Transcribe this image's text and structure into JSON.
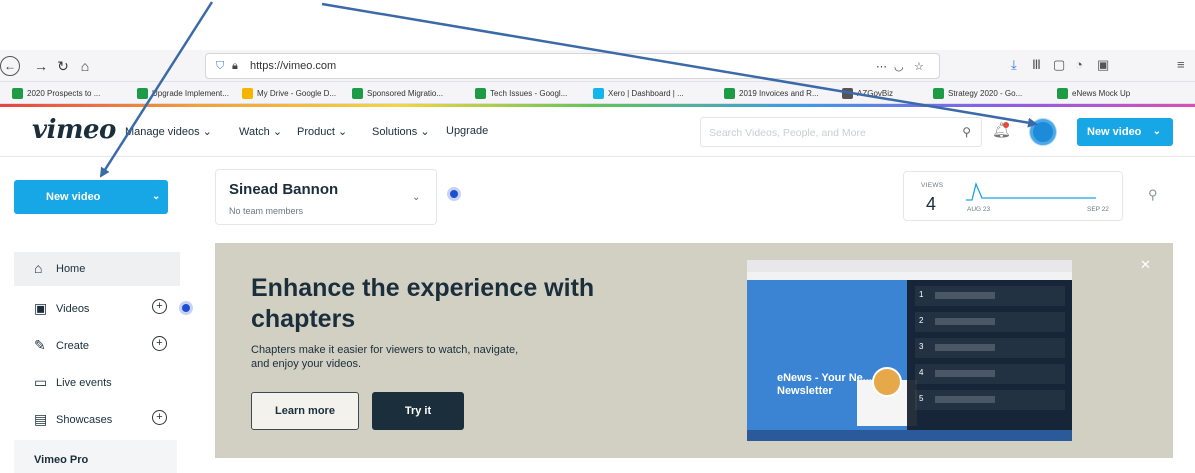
{
  "browser": {
    "url": "https://vimeo.com",
    "toolbar_icons": [
      "back-icon",
      "forward-icon",
      "reload-icon",
      "home-icon",
      "shield-icon",
      "lock-icon",
      "more-icon",
      "pocket-icon",
      "star-icon",
      "download-icon",
      "library-icon",
      "sidebar-icon",
      "extension-icon",
      "menu-icon"
    ],
    "bookmarks": [
      {
        "label": "2020 Prospects to ...",
        "color": "#1e9c45"
      },
      {
        "label": "Upgrade Implement...",
        "color": "#1e9c45"
      },
      {
        "label": "My Drive - Google D...",
        "color": "#f4b400"
      },
      {
        "label": "Sponsored Migratio...",
        "color": "#1e9c45"
      },
      {
        "label": "Tech Issues - Googl...",
        "color": "#1e9c45"
      },
      {
        "label": "Xero | Dashboard | ...",
        "color": "#13b5ea"
      },
      {
        "label": "2019 Invoices and R...",
        "color": "#1e9c45"
      },
      {
        "label": "AZGovBiz",
        "color": "#555555"
      },
      {
        "label": "Strategy 2020 - Go...",
        "color": "#1e9c45"
      },
      {
        "label": "eNews Mock Up",
        "color": "#1e9c45"
      }
    ]
  },
  "header": {
    "logo": "vimeo",
    "menu": [
      {
        "label": "Manage videos",
        "has_chevron": true
      },
      {
        "label": "Watch",
        "has_chevron": true
      },
      {
        "label": "Product",
        "has_chevron": true
      },
      {
        "label": "Solutions",
        "has_chevron": true
      },
      {
        "label": "Upgrade",
        "has_chevron": false
      }
    ],
    "search_placeholder": "Search Videos, People, and More",
    "new_video_label": "New video"
  },
  "sidebar": {
    "new_video_label": "New video",
    "items": [
      {
        "label": "Home",
        "icon": "home-icon",
        "has_plus": false,
        "active": true
      },
      {
        "label": "Videos",
        "icon": "video-icon",
        "has_plus": true,
        "active": false
      },
      {
        "label": "Create",
        "icon": "create-icon",
        "has_plus": true,
        "active": false
      },
      {
        "label": "Live events",
        "icon": "live-icon",
        "has_plus": false,
        "active": false
      },
      {
        "label": "Showcases",
        "icon": "showcase-icon",
        "has_plus": true,
        "active": false
      }
    ],
    "vimeo_pro_label": "Vimeo Pro"
  },
  "team": {
    "name": "Sinead Bannon",
    "subtitle": "No team members"
  },
  "views": {
    "label": "VIEWS",
    "count": "4",
    "start_date": "AUG 23",
    "end_date": "SEP 22",
    "accent": "#17a6e6"
  },
  "banner": {
    "heading": "Enhance the experience with chapters",
    "description": "Chapters make it easier for viewers to watch, navigate, and enjoy your videos.",
    "learn_more_label": "Learn more",
    "try_it_label": "Try it",
    "preview_text": "eNews - Your Ne... Newsletter",
    "preview_chapters": [
      "1",
      "2",
      "3",
      "4",
      "5"
    ]
  },
  "colors": {
    "brand_blue": "#17a6e6",
    "navy": "#1a2e3b",
    "banner_bg": "#d2d0c3",
    "annotation_arrow": "#3a6aa8"
  }
}
